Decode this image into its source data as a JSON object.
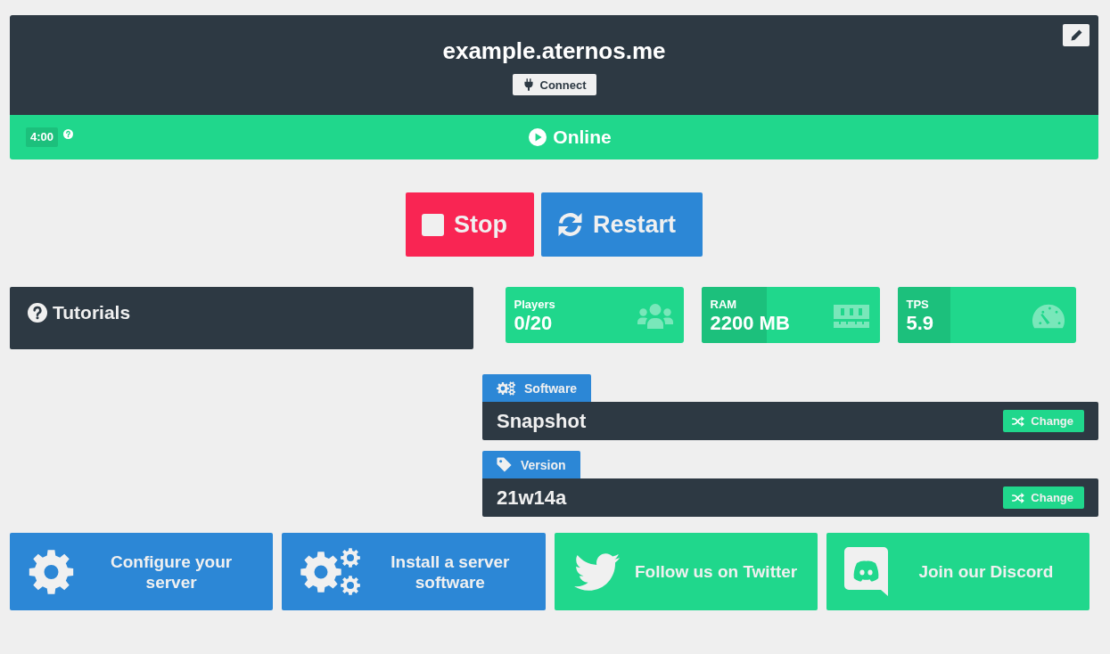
{
  "server": {
    "address": "example.aternos.me",
    "connect_label": "Connect"
  },
  "status": {
    "kind": "online",
    "label": "Online",
    "timer": "4:00"
  },
  "controls": [
    {
      "kind": "stop",
      "label": "Stop"
    },
    {
      "kind": "restart",
      "label": "Restart"
    }
  ],
  "tutorials": {
    "title": "Tutorials"
  },
  "stats": [
    {
      "kind": "players",
      "label": "Players",
      "value": "0/20"
    },
    {
      "kind": "ram",
      "label": "RAM",
      "value": "2200 MB",
      "level": 0.365
    },
    {
      "kind": "tps",
      "label": "TPS",
      "value": "5.9",
      "level": 0.295
    }
  ],
  "settings": [
    {
      "kind": "software",
      "label": "Software",
      "value": "Snapshot",
      "button": "Change"
    },
    {
      "kind": "version",
      "label": "Version",
      "value": "21w14a",
      "button": "Change"
    }
  ],
  "links": [
    {
      "kind": "configure",
      "label": "Configure your server",
      "color": "#2c87d6"
    },
    {
      "kind": "install",
      "label": "Install a server software",
      "color": "#2c87d6"
    },
    {
      "kind": "twitter",
      "label": "Follow us on Twitter",
      "color": "#20d78c"
    },
    {
      "kind": "discord",
      "label": "Join our Discord",
      "color": "#20d78c"
    }
  ]
}
